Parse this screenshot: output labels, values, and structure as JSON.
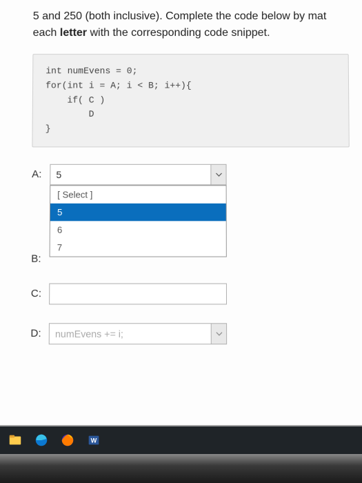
{
  "question": {
    "line1": "5 and 250 (both inclusive). Complete the code below by mat",
    "line2_prefix": "each ",
    "line2_bold": "letter",
    "line2_suffix": " with the corresponding code snippet."
  },
  "code": {
    "l1": "int numEvens = 0;",
    "l2": "for(int i = A; i < B; i++){",
    "l3": "    if( C )",
    "l4": "        D",
    "l5": "}"
  },
  "answers": {
    "A": {
      "label": "A:",
      "value": "5"
    },
    "B": {
      "label": "B:",
      "value": ""
    },
    "C": {
      "label": "C:",
      "value": ""
    },
    "D": {
      "label": "D:",
      "value": "numEvens += i;"
    }
  },
  "dropdown": {
    "placeholder": "[ Select ]",
    "options": [
      "5",
      "6",
      "7"
    ],
    "highlighted": "5"
  },
  "taskbar": {
    "icons": [
      "files",
      "edge",
      "firefox",
      "word"
    ]
  }
}
